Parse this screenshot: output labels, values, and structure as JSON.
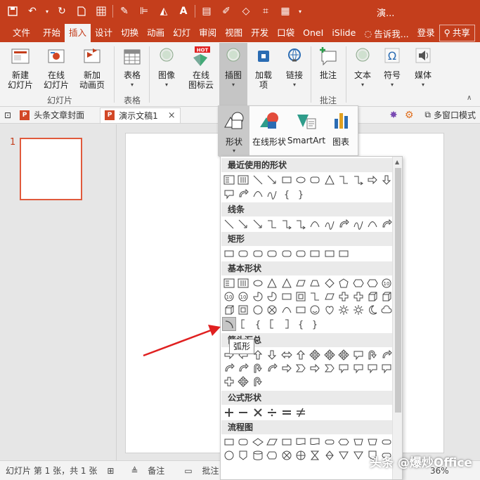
{
  "title_bar": {
    "doc_title": "演..."
  },
  "tabs": [
    {
      "label": "文件"
    },
    {
      "label": "开始"
    },
    {
      "label": "插入"
    },
    {
      "label": "设计"
    },
    {
      "label": "切换"
    },
    {
      "label": "动画"
    },
    {
      "label": "幻灯"
    },
    {
      "label": "审阅"
    },
    {
      "label": "视图"
    },
    {
      "label": "开发"
    },
    {
      "label": "口袋"
    },
    {
      "label": "OneI"
    },
    {
      "label": "iSlide"
    }
  ],
  "tellme": "告诉我...",
  "login": "登录",
  "share": "共享",
  "ribbon": {
    "new_slide": "新建\n幻灯片",
    "online_slide": "在线\n幻灯片",
    "new_anim_page": "新加\n动画页",
    "group_slides": "幻灯片",
    "table": "表格",
    "group_table": "表格",
    "image": "图像",
    "online_cloud": "在线\n图标云",
    "hot_badge": "HOT",
    "illustrations": "插图",
    "addins": "加载\n项",
    "links": "链接",
    "comment": "批注",
    "group_comment": "批注",
    "text": "文本",
    "symbols": "符号",
    "media": "媒体"
  },
  "doc_tabs": [
    {
      "label": "头条文章封面"
    },
    {
      "label": "演示文稿1"
    }
  ],
  "multi_window": "多窗口模式",
  "thumbnail_number": "1",
  "illustrations_menu": [
    {
      "label": "形状"
    },
    {
      "label": "在线形状"
    },
    {
      "label": "SmartArt"
    },
    {
      "label": "图表"
    }
  ],
  "shape_sections": [
    {
      "title": "最近使用的形状"
    },
    {
      "title": "线条"
    },
    {
      "title": "矩形"
    },
    {
      "title": "基本形状"
    },
    {
      "title": "箭头汇总"
    },
    {
      "title": "公式形状"
    },
    {
      "title": "流程图"
    }
  ],
  "tooltip": "弧形",
  "status": {
    "slide_info": "幻灯片 第 1 张，共 1 张",
    "notes": "备注",
    "comments": "批注",
    "zoom": "36%"
  },
  "watermark": "头条 @爆炒Office",
  "colors": {
    "accent": "#c43e1c",
    "thumb_border": "#e05a3c",
    "arrow": "#e02020"
  }
}
